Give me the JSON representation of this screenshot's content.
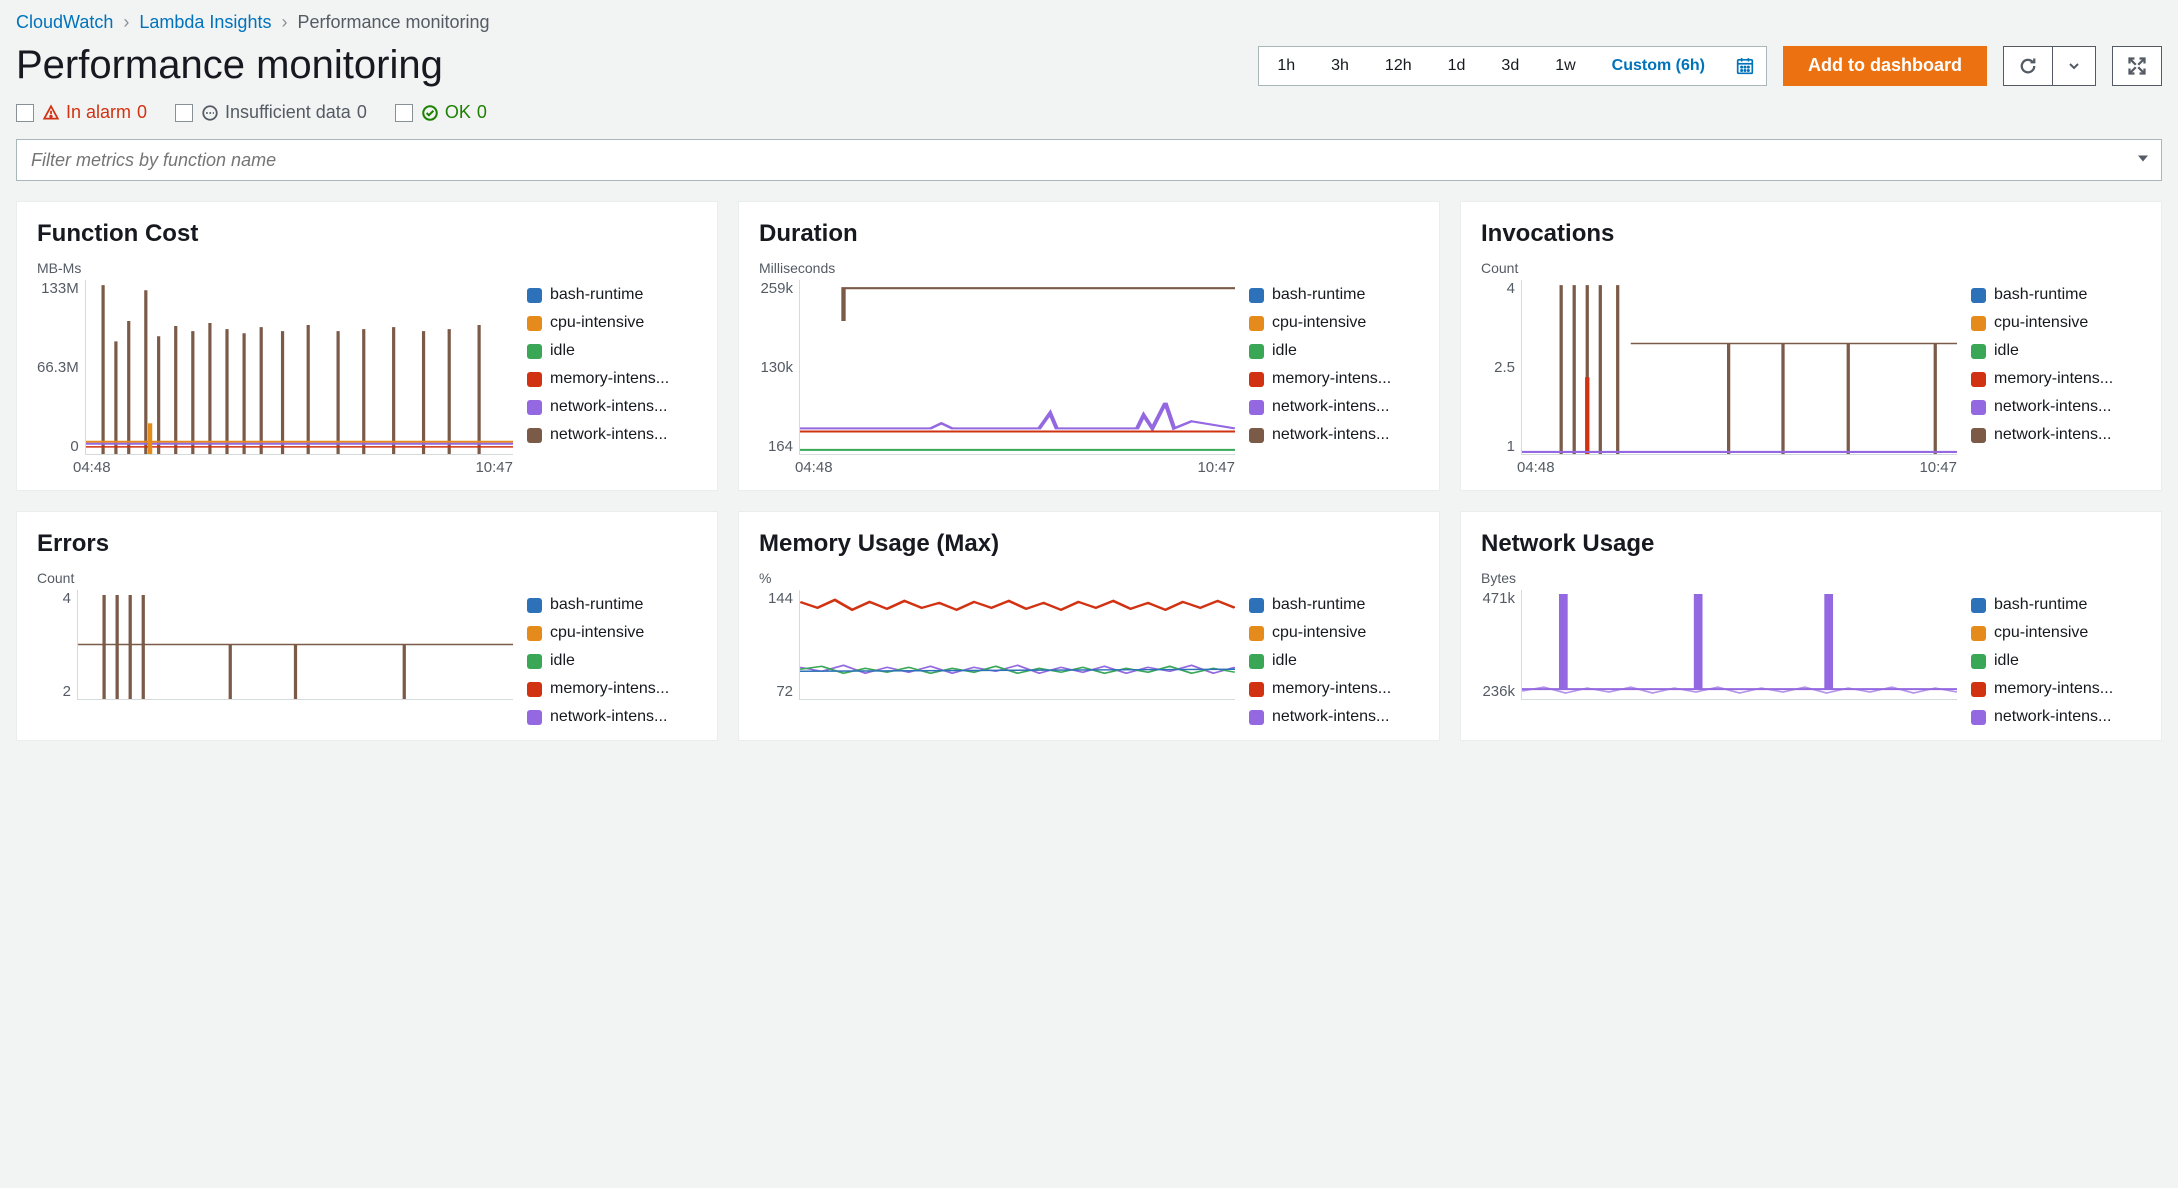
{
  "breadcrumb": {
    "root": "CloudWatch",
    "section": "Lambda Insights",
    "current": "Performance monitoring"
  },
  "page_title": "Performance monitoring",
  "time_picker": {
    "options": [
      "1h",
      "3h",
      "12h",
      "1d",
      "3d",
      "1w"
    ],
    "custom_label": "Custom (6h)"
  },
  "actions": {
    "add_dashboard": "Add to dashboard"
  },
  "status": {
    "alarm": {
      "label": "In alarm",
      "count": 0
    },
    "insufficient": {
      "label": "Insufficient data",
      "count": 0
    },
    "ok": {
      "label": "OK",
      "count": 0
    }
  },
  "filter": {
    "placeholder": "Filter metrics by function name"
  },
  "legend_series": [
    {
      "name": "bash-runtime",
      "color": "#2d72b8"
    },
    {
      "name": "cpu-intensive",
      "color": "#e58b1b"
    },
    {
      "name": "idle",
      "color": "#3aa757"
    },
    {
      "name": "memory-intens...",
      "color": "#d13212"
    },
    {
      "name": "network-intens...",
      "color": "#9468e0"
    },
    {
      "name": "network-intens...",
      "color": "#7b5a48"
    }
  ],
  "legend_series_short": [
    {
      "name": "bash-runtime",
      "color": "#2d72b8"
    },
    {
      "name": "cpu-intensive",
      "color": "#e58b1b"
    },
    {
      "name": "idle",
      "color": "#3aa757"
    },
    {
      "name": "memory-intens...",
      "color": "#d13212"
    },
    {
      "name": "network-intens...",
      "color": "#9468e0"
    }
  ],
  "cards": {
    "function_cost": {
      "title": "Function Cost",
      "unit": "MB-Ms",
      "y_ticks": [
        "133M",
        "66.3M",
        "0"
      ],
      "x_ticks": [
        "04:48",
        "10:47"
      ]
    },
    "duration": {
      "title": "Duration",
      "unit": "Milliseconds",
      "y_ticks": [
        "259k",
        "130k",
        "164"
      ],
      "x_ticks": [
        "04:48",
        "10:47"
      ]
    },
    "invocations": {
      "title": "Invocations",
      "unit": "Count",
      "y_ticks": [
        "4",
        "2.5",
        "1"
      ],
      "x_ticks": [
        "04:48",
        "10:47"
      ]
    },
    "errors": {
      "title": "Errors",
      "unit": "Count",
      "y_ticks": [
        "4",
        "2"
      ],
      "x_ticks": []
    },
    "memory_usage": {
      "title": "Memory Usage (Max)",
      "unit": "%",
      "y_ticks": [
        "144",
        "72"
      ],
      "x_ticks": []
    },
    "network_usage": {
      "title": "Network Usage",
      "unit": "Bytes",
      "y_ticks": [
        "471k",
        "236k"
      ],
      "x_ticks": []
    }
  },
  "chart_data": [
    {
      "type": "line",
      "title": "Function Cost",
      "ylabel": "MB-Ms",
      "xlabel": "",
      "x_range": [
        "04:48",
        "10:47"
      ],
      "ylim": [
        0,
        133000000
      ],
      "series": [
        {
          "name": "network-intens",
          "color": "#7b5a48",
          "pattern": "spiky-vertical-bars",
          "approx_range": [
            0,
            133000000
          ]
        },
        {
          "name": "cpu-intensive",
          "color": "#e58b1b",
          "pattern": "low-flat-with-spikes",
          "approx_value": 10000000
        },
        {
          "name": "network-intens",
          "color": "#9468e0",
          "pattern": "low-flat",
          "approx_value": 8000000
        },
        {
          "name": "memory-intens",
          "color": "#d13212",
          "pattern": "low-flat",
          "approx_value": 6000000
        },
        {
          "name": "idle",
          "color": "#3aa757",
          "pattern": "near-zero",
          "approx_value": 1000000
        },
        {
          "name": "bash-runtime",
          "color": "#2d72b8",
          "pattern": "near-zero",
          "approx_value": 500000
        }
      ]
    },
    {
      "type": "line",
      "title": "Duration",
      "ylabel": "Milliseconds",
      "xlabel": "",
      "x_range": [
        "04:48",
        "10:47"
      ],
      "ylim": [
        164,
        259000
      ],
      "series": [
        {
          "name": "network-intens",
          "color": "#7b5a48",
          "pattern": "step-up-then-flat",
          "approx_value": 259000
        },
        {
          "name": "network-intens",
          "color": "#9468e0",
          "pattern": "flat-with-small-spikes",
          "approx_value": 20000
        },
        {
          "name": "memory-intens",
          "color": "#d13212",
          "pattern": "flat",
          "approx_value": 18000
        },
        {
          "name": "idle",
          "color": "#3aa757",
          "pattern": "flat-near-bottom",
          "approx_value": 1000
        },
        {
          "name": "cpu-intensive",
          "color": "#e58b1b",
          "pattern": "flat",
          "approx_value": 15000
        },
        {
          "name": "bash-runtime",
          "color": "#2d72b8",
          "pattern": "flat",
          "approx_value": 14000
        }
      ]
    },
    {
      "type": "line",
      "title": "Invocations",
      "ylabel": "Count",
      "xlabel": "",
      "x_range": [
        "04:48",
        "10:47"
      ],
      "ylim": [
        1,
        4
      ],
      "series": [
        {
          "name": "network-intens",
          "color": "#7b5a48",
          "pattern": "spiky-1-to-4",
          "approx_range": [
            1,
            4
          ]
        },
        {
          "name": "memory-intens",
          "color": "#d13212",
          "pattern": "early-spike-then-1",
          "approx_value": 1
        },
        {
          "name": "network-intens",
          "color": "#9468e0",
          "pattern": "flat",
          "approx_value": 1
        },
        {
          "name": "idle",
          "color": "#3aa757",
          "pattern": "flat",
          "approx_value": 1
        },
        {
          "name": "cpu-intensive",
          "color": "#e58b1b",
          "pattern": "flat",
          "approx_value": 1
        },
        {
          "name": "bash-runtime",
          "color": "#2d72b8",
          "pattern": "flat",
          "approx_value": 1
        }
      ]
    },
    {
      "type": "line",
      "title": "Errors",
      "ylabel": "Count",
      "xlabel": "",
      "x_range": [
        "04:48",
        "10:47"
      ],
      "ylim": [
        0,
        4
      ],
      "series": [
        {
          "name": "network-intens",
          "color": "#7b5a48",
          "pattern": "spiky",
          "approx_range": [
            0,
            4
          ]
        }
      ]
    },
    {
      "type": "line",
      "title": "Memory Usage (Max)",
      "ylabel": "%",
      "xlabel": "",
      "x_range": [
        "04:48",
        "10:47"
      ],
      "ylim": [
        0,
        144
      ],
      "series": [
        {
          "name": "memory-intens",
          "color": "#d13212",
          "pattern": "noisy-flat",
          "approx_value": 138
        },
        {
          "name": "network-intens",
          "color": "#9468e0",
          "pattern": "noisy-flat",
          "approx_value": 80
        },
        {
          "name": "idle",
          "color": "#3aa757",
          "pattern": "noisy-flat",
          "approx_value": 78
        },
        {
          "name": "cpu-intensive",
          "color": "#e58b1b",
          "pattern": "noisy-flat",
          "approx_value": 76
        },
        {
          "name": "bash-runtime",
          "color": "#2d72b8",
          "pattern": "noisy-flat",
          "approx_value": 75
        }
      ]
    },
    {
      "type": "line",
      "title": "Network Usage",
      "ylabel": "Bytes",
      "xlabel": "",
      "x_range": [
        "04:48",
        "10:47"
      ],
      "ylim": [
        0,
        471000
      ],
      "series": [
        {
          "name": "network-intens",
          "color": "#9468e0",
          "pattern": "periodic-spikes-to-max",
          "baseline": 236000,
          "spike": 471000
        }
      ]
    }
  ]
}
